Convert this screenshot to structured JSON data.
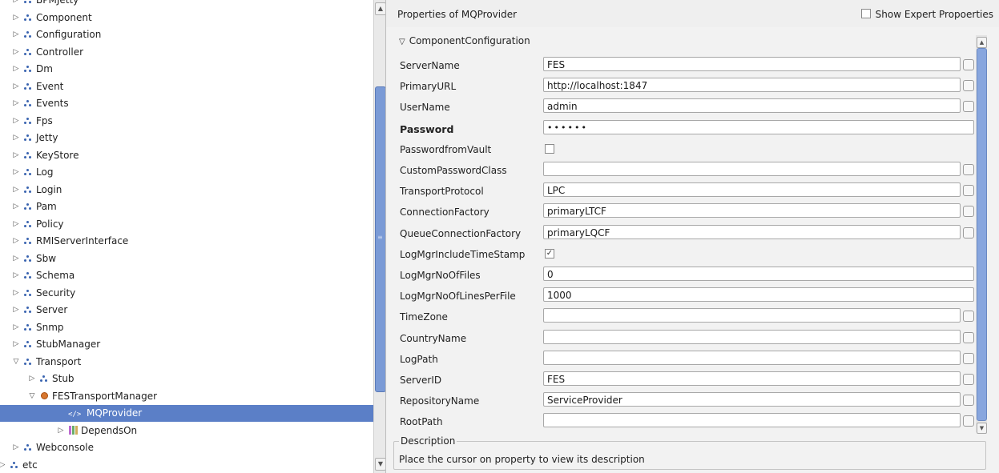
{
  "tree": {
    "items": [
      {
        "label": "BPMJetty",
        "type": "pkg",
        "level": 0,
        "expanded": false
      },
      {
        "label": "Component",
        "type": "pkg",
        "level": 0,
        "expanded": false
      },
      {
        "label": "Configuration",
        "type": "pkg",
        "level": 0,
        "expanded": false
      },
      {
        "label": "Controller",
        "type": "pkg",
        "level": 0,
        "expanded": false
      },
      {
        "label": "Dm",
        "type": "pkg",
        "level": 0,
        "expanded": false
      },
      {
        "label": "Event",
        "type": "pkg",
        "level": 0,
        "expanded": false
      },
      {
        "label": "Events",
        "type": "pkg",
        "level": 0,
        "expanded": false
      },
      {
        "label": "Fps",
        "type": "pkg",
        "level": 0,
        "expanded": false
      },
      {
        "label": "Jetty",
        "type": "pkg",
        "level": 0,
        "expanded": false
      },
      {
        "label": "KeyStore",
        "type": "pkg",
        "level": 0,
        "expanded": false
      },
      {
        "label": "Log",
        "type": "pkg",
        "level": 0,
        "expanded": false
      },
      {
        "label": "Login",
        "type": "pkg",
        "level": 0,
        "expanded": false
      },
      {
        "label": "Pam",
        "type": "pkg",
        "level": 0,
        "expanded": false
      },
      {
        "label": "Policy",
        "type": "pkg",
        "level": 0,
        "expanded": false
      },
      {
        "label": "RMIServerInterface",
        "type": "pkg",
        "level": 0,
        "expanded": false
      },
      {
        "label": "Sbw",
        "type": "pkg",
        "level": 0,
        "expanded": false
      },
      {
        "label": "Schema",
        "type": "pkg",
        "level": 0,
        "expanded": false
      },
      {
        "label": "Security",
        "type": "pkg",
        "level": 0,
        "expanded": false
      },
      {
        "label": "Server",
        "type": "pkg",
        "level": 0,
        "expanded": false
      },
      {
        "label": "Snmp",
        "type": "pkg",
        "level": 0,
        "expanded": false
      },
      {
        "label": "StubManager",
        "type": "pkg",
        "level": 0,
        "expanded": false
      },
      {
        "label": "Transport",
        "type": "pkg",
        "level": 0,
        "expanded": true
      },
      {
        "label": "Stub",
        "type": "pkg",
        "level": 1,
        "expanded": false
      },
      {
        "label": "FESTransportManager",
        "type": "bean",
        "level": 1,
        "expanded": true
      },
      {
        "label": "MQProvider",
        "type": "mq",
        "level": 2,
        "selected": true
      },
      {
        "label": "DependsOn",
        "type": "dep",
        "level": 2,
        "expanded": false
      },
      {
        "label": "Webconsole",
        "type": "pkg",
        "level": 0,
        "expanded": false
      },
      {
        "label": "etc",
        "type": "pkg",
        "level": -1,
        "expanded": false
      }
    ]
  },
  "props": {
    "title": "Properties of MQProvider",
    "expert_label": "Show Expert Propoerties",
    "section": "ComponentConfiguration",
    "rows": [
      {
        "label": "ServerName",
        "value": "FES",
        "kind": "text"
      },
      {
        "label": "PrimaryURL",
        "value": "http://localhost:1847",
        "kind": "text"
      },
      {
        "label": "UserName",
        "value": "admin",
        "kind": "text"
      },
      {
        "label": "Password",
        "value": "••••••",
        "kind": "password",
        "bold": true
      },
      {
        "label": "PasswordfromVault",
        "value": "",
        "kind": "check",
        "checked": false
      },
      {
        "label": "CustomPasswordClass",
        "value": "",
        "kind": "text"
      },
      {
        "label": "TransportProtocol",
        "value": "LPC",
        "kind": "text"
      },
      {
        "label": "ConnectionFactory",
        "value": "primaryLTCF",
        "kind": "text"
      },
      {
        "label": "QueueConnectionFactory",
        "value": "primaryLQCF",
        "kind": "text"
      },
      {
        "label": "LogMgrIncludeTimeStamp",
        "value": "",
        "kind": "check",
        "checked": true
      },
      {
        "label": "LogMgrNoOfFiles",
        "value": "0",
        "kind": "full"
      },
      {
        "label": "LogMgrNoOfLinesPerFile",
        "value": "1000",
        "kind": "full"
      },
      {
        "label": "TimeZone",
        "value": "",
        "kind": "text"
      },
      {
        "label": "CountryName",
        "value": "",
        "kind": "text"
      },
      {
        "label": "LogPath",
        "value": "",
        "kind": "text"
      },
      {
        "label": "ServerID",
        "value": "FES",
        "kind": "text"
      },
      {
        "label": "RepositoryName",
        "value": "ServiceProvider",
        "kind": "text"
      },
      {
        "label": "RootPath",
        "value": "",
        "kind": "text"
      }
    ],
    "description_label": "Description",
    "description_text": "Place the cursor on property to view its description"
  },
  "colors": {
    "selection": "#5b7fc7",
    "scroll_thumb": "#7a9ad6"
  }
}
